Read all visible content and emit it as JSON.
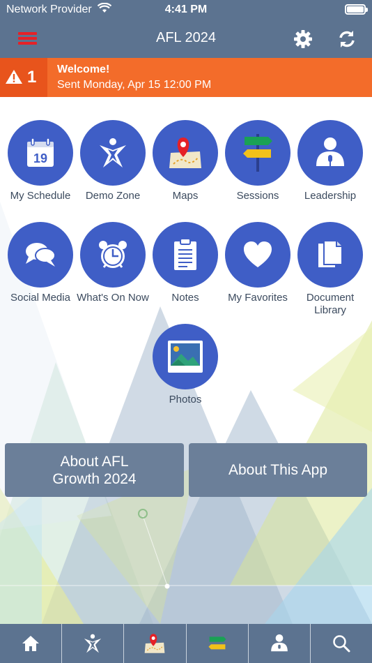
{
  "status_bar": {
    "carrier": "Network Provider",
    "time": "4:41 PM"
  },
  "nav": {
    "title": "AFL 2024"
  },
  "alert": {
    "count": "1",
    "title": "Welcome!",
    "subtitle": "Sent Monday, Apr 15 12:00 PM"
  },
  "tiles": [
    {
      "label": "My Schedule",
      "icon": "calendar-icon",
      "calendar_day": "19"
    },
    {
      "label": "Demo Zone",
      "icon": "star-figure-icon"
    },
    {
      "label": "Maps",
      "icon": "map-pin-icon"
    },
    {
      "label": "Sessions",
      "icon": "signpost-icon"
    },
    {
      "label": "Leadership",
      "icon": "speaker-icon"
    },
    {
      "label": "Social Media",
      "icon": "chat-bubbles-icon"
    },
    {
      "label": "What's On Now",
      "icon": "alarm-clock-icon"
    },
    {
      "label": "Notes",
      "icon": "clipboard-icon"
    },
    {
      "label": "My Favorites",
      "icon": "heart-icon"
    },
    {
      "label": "Document Library",
      "icon": "documents-icon"
    },
    {
      "label": "Photos",
      "icon": "photo-icon"
    }
  ],
  "about": {
    "afl_label": "About AFL Growth 2024",
    "app_label": "About This App"
  },
  "tab_bar": [
    {
      "icon": "home-icon"
    },
    {
      "icon": "star-figure-icon"
    },
    {
      "icon": "map-pin-icon"
    },
    {
      "icon": "signpost-icon"
    },
    {
      "icon": "speaker-icon"
    },
    {
      "icon": "search-icon"
    }
  ],
  "colors": {
    "bar": "#5c7390",
    "accent_circle": "#3f5ec6",
    "alert": "#f36c2a",
    "alert_badge": "#e8541c",
    "hamburger": "#e52127",
    "about_button": "#6b7f99"
  }
}
